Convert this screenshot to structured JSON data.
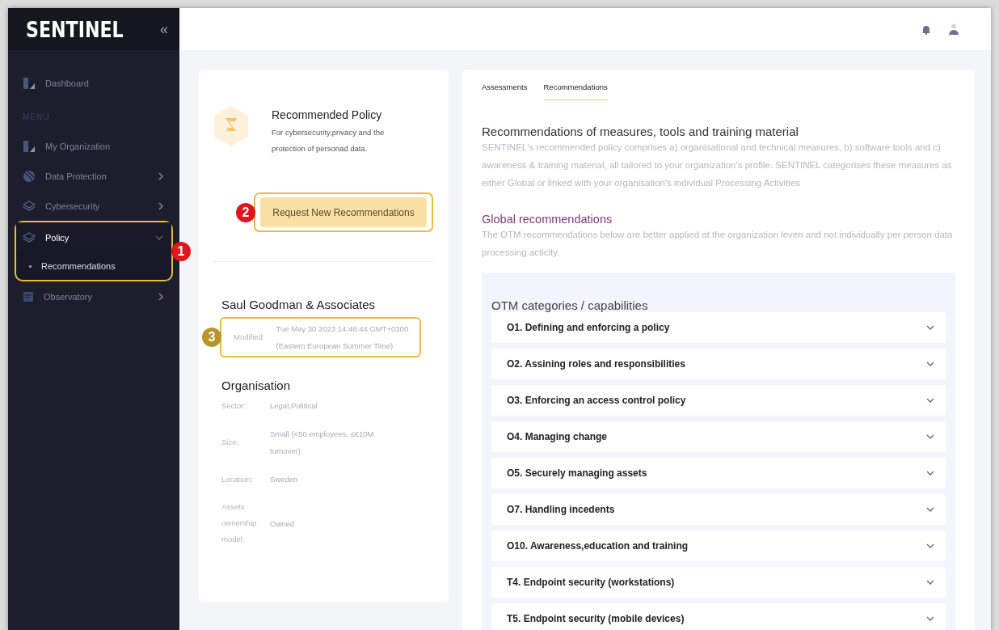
{
  "logo": "SENTINEL",
  "collapse_glyph": "«",
  "sidebar": {
    "items": [
      {
        "kind": "item",
        "label": "Dashboard",
        "selected": false
      },
      {
        "kind": "section",
        "label": "MENU"
      },
      {
        "kind": "item",
        "label": "My Organization",
        "selected": false
      },
      {
        "kind": "item",
        "label": "Data Protection",
        "expanded": false,
        "selected": false
      },
      {
        "kind": "item",
        "label": "Cybersecurity",
        "expanded": false,
        "selected": false
      },
      {
        "kind": "item",
        "label": "Policy",
        "expanded": true,
        "selected": true,
        "marker": {
          "number": "1",
          "color": "#e0161e"
        },
        "children": [
          {
            "label": "Recommendations",
            "selected": true
          }
        ]
      },
      {
        "kind": "item",
        "label": "Observatory",
        "expanded": false,
        "selected": false
      }
    ]
  },
  "policy_card": {
    "title": "Recommended Policy",
    "description": "For cybersecurity,privacy and the protection of personad data.",
    "button": {
      "label": "Request New Recommendations",
      "marker": {
        "number": "2",
        "color": "#e0161e"
      }
    },
    "org_name": "Saul Goodman & Associates",
    "modified": {
      "label": "Modified:",
      "value_lines": [
        "Tue May 30 2023 14:48:44 GMT+0300",
        "(Eastern European Summer Time)"
      ],
      "marker": {
        "number": "3",
        "color": "#b8952a"
      }
    },
    "organisation_title": "Organisation",
    "fields": [
      {
        "label_lines": [
          "Sector:"
        ],
        "value_lines": [
          "Legal,Political"
        ]
      },
      {
        "label_lines": [
          "Size:"
        ],
        "value_lines": [
          "Small (<50 employees, ≤€10M",
          "turnover)"
        ]
      },
      {
        "label_lines": [
          "Location:"
        ],
        "value_lines": [
          "Sweden"
        ]
      },
      {
        "label_lines": [
          "Assets",
          "ownership",
          "model:"
        ],
        "value_lines": [
          "Owned"
        ]
      }
    ]
  },
  "tabs": [
    {
      "label": "Assessments",
      "selected": false
    },
    {
      "label": "Recommendations",
      "selected": true
    }
  ],
  "intro": {
    "title": "Recommendations of measures, tools and training material",
    "text": "SENTINEL's recommended policy comprises a) organisational and technical measures, b) software tools and c) awareness & training material, all tailored to your organization's profile. SENTINEL categorises these measures as either Global or linked with your organisation's individual Processing Activities"
  },
  "global": {
    "title": "Global recommendations",
    "text": "The OTM recommendations below are better applied at the organization leven and not individually per person data processing acticity."
  },
  "otm": {
    "title": "OTM categories / capabilities",
    "items": [
      {
        "label": "O1. Defining and enforcing a policy",
        "expanded": false
      },
      {
        "label": "O2. Assining roles and responsibilities",
        "expanded": false
      },
      {
        "label": "O3. Enforcing an access control policy",
        "expanded": false
      },
      {
        "label": "O4. Managing change",
        "expanded": false
      },
      {
        "label": "O5. Securely managing assets",
        "expanded": false
      },
      {
        "label": "O7. Handling incedents",
        "expanded": false
      },
      {
        "label": "O10. Awareness,education and training",
        "expanded": false
      },
      {
        "label": "T4. Endpoint security (workstations)",
        "expanded": false
      },
      {
        "label": "T5. Endpoint security (mobile devices)",
        "expanded": false
      }
    ]
  }
}
